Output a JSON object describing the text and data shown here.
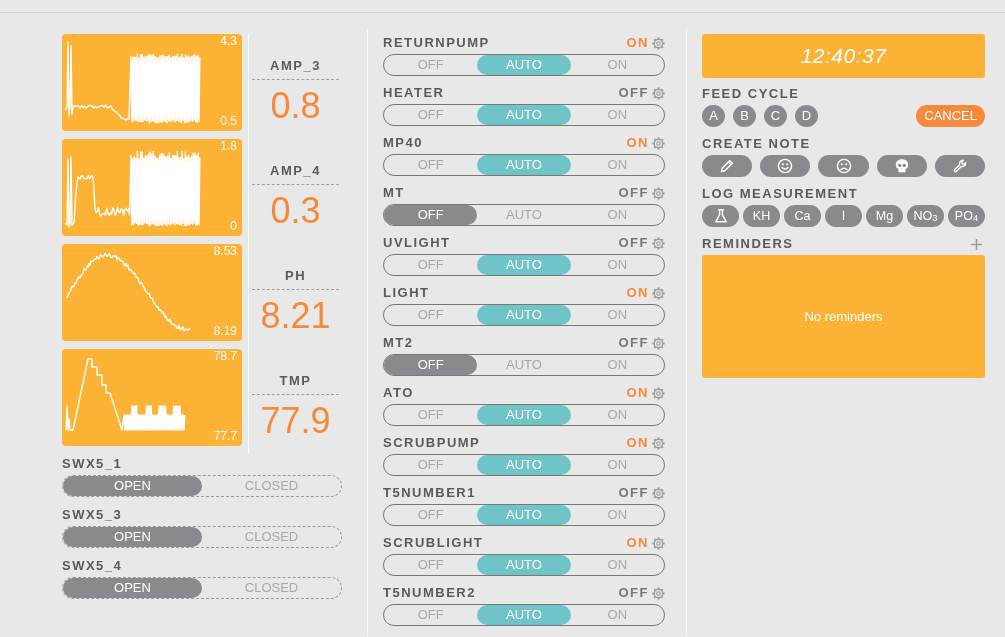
{
  "sensors": [
    {
      "label": "AMP_3",
      "value": "0.8",
      "max": "4.3",
      "min": "0.5"
    },
    {
      "label": "AMP_4",
      "value": "0.3",
      "max": "1.8",
      "min": "0"
    },
    {
      "label": "PH",
      "value": "8.21",
      "max": "8.53",
      "min": "8.19"
    },
    {
      "label": "TMP",
      "value": "77.9",
      "max": "78.7",
      "min": "77.7"
    }
  ],
  "switches": [
    {
      "name": "SWX5_1",
      "options": [
        {
          "label": "OPEN",
          "selected": true
        },
        {
          "label": "CLOSED",
          "selected": false
        }
      ]
    },
    {
      "name": "SWX5_3",
      "options": [
        {
          "label": "OPEN",
          "selected": true
        },
        {
          "label": "CLOSED",
          "selected": false
        }
      ]
    },
    {
      "name": "SWX5_4",
      "options": [
        {
          "label": "OPEN",
          "selected": true
        },
        {
          "label": "CLOSED",
          "selected": false
        }
      ]
    }
  ],
  "outlets": [
    {
      "name": "RETURNPUMP",
      "status": "ON",
      "on": true,
      "modes": [
        {
          "label": "OFF",
          "selected": false
        },
        {
          "label": "AUTO",
          "selected": true
        },
        {
          "label": "ON",
          "selected": false
        }
      ]
    },
    {
      "name": "HEATER",
      "status": "OFF",
      "on": false,
      "modes": [
        {
          "label": "OFF",
          "selected": false
        },
        {
          "label": "AUTO",
          "selected": true
        },
        {
          "label": "ON",
          "selected": false
        }
      ]
    },
    {
      "name": "MP40",
      "status": "ON",
      "on": true,
      "modes": [
        {
          "label": "OFF",
          "selected": false
        },
        {
          "label": "AUTO",
          "selected": true
        },
        {
          "label": "ON",
          "selected": false
        }
      ]
    },
    {
      "name": "MT",
      "status": "OFF",
      "on": false,
      "modes": [
        {
          "label": "OFF",
          "selected": true
        },
        {
          "label": "AUTO",
          "selected": false
        },
        {
          "label": "ON",
          "selected": false
        }
      ]
    },
    {
      "name": "UVLIGHT",
      "status": "OFF",
      "on": false,
      "modes": [
        {
          "label": "OFF",
          "selected": false
        },
        {
          "label": "AUTO",
          "selected": true
        },
        {
          "label": "ON",
          "selected": false
        }
      ]
    },
    {
      "name": "LIGHT",
      "status": "ON",
      "on": true,
      "modes": [
        {
          "label": "OFF",
          "selected": false
        },
        {
          "label": "AUTO",
          "selected": true
        },
        {
          "label": "ON",
          "selected": false
        }
      ]
    },
    {
      "name": "MT2",
      "status": "OFF",
      "on": false,
      "modes": [
        {
          "label": "OFF",
          "selected": true
        },
        {
          "label": "AUTO",
          "selected": false
        },
        {
          "label": "ON",
          "selected": false
        }
      ]
    },
    {
      "name": "ATO",
      "status": "ON",
      "on": true,
      "modes": [
        {
          "label": "OFF",
          "selected": false
        },
        {
          "label": "AUTO",
          "selected": true
        },
        {
          "label": "ON",
          "selected": false
        }
      ]
    },
    {
      "name": "SCRUBPUMP",
      "status": "ON",
      "on": true,
      "modes": [
        {
          "label": "OFF",
          "selected": false
        },
        {
          "label": "AUTO",
          "selected": true
        },
        {
          "label": "ON",
          "selected": false
        }
      ]
    },
    {
      "name": "T5NUMBER1",
      "status": "OFF",
      "on": false,
      "modes": [
        {
          "label": "OFF",
          "selected": false
        },
        {
          "label": "AUTO",
          "selected": true
        },
        {
          "label": "ON",
          "selected": false
        }
      ]
    },
    {
      "name": "SCRUBLIGHT",
      "status": "ON",
      "on": true,
      "modes": [
        {
          "label": "OFF",
          "selected": false
        },
        {
          "label": "AUTO",
          "selected": true
        },
        {
          "label": "ON",
          "selected": false
        }
      ]
    },
    {
      "name": "T5NUMBER2",
      "status": "OFF",
      "on": false,
      "modes": [
        {
          "label": "OFF",
          "selected": false
        },
        {
          "label": "AUTO",
          "selected": true
        },
        {
          "label": "ON",
          "selected": false
        }
      ]
    }
  ],
  "clock": {
    "time": "12:40:37"
  },
  "feed_cycle": {
    "title": "FEED CYCLE",
    "buttons": [
      "A",
      "B",
      "C",
      "D"
    ],
    "cancel": "CANCEL"
  },
  "create_note": {
    "title": "CREATE NOTE"
  },
  "log_measurement": {
    "title": "LOG MEASUREMENT",
    "buttons": [
      "KH",
      "Ca",
      "I",
      "Mg",
      "NO$_{3}$",
      "PO$_{4}$"
    ]
  },
  "reminders": {
    "title": "REMINDERS",
    "empty_text": "No reminders"
  }
}
